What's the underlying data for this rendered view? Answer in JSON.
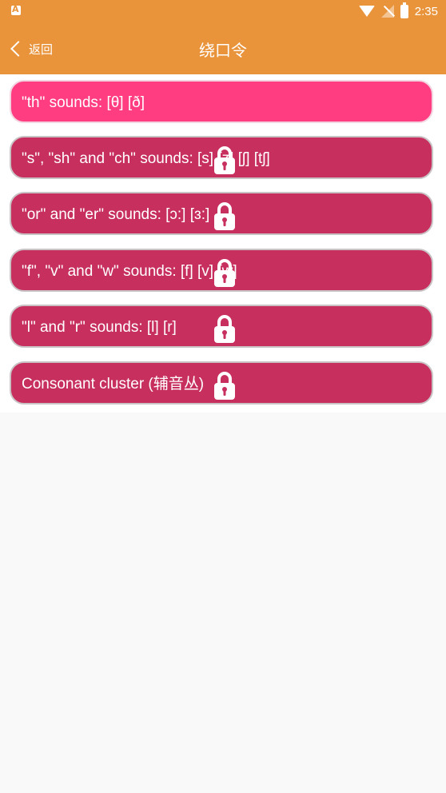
{
  "status_bar": {
    "time": "2:35"
  },
  "nav": {
    "back_label": "返回",
    "title": "绕口令"
  },
  "items": [
    {
      "label": "\"th\" sounds: [θ] [ð]",
      "locked": false
    },
    {
      "label": "\"s\", \"sh\" and \"ch\" sounds: [s] [z] [ʃ] [tʃ]",
      "locked": true
    },
    {
      "label": "\"or\" and \"er\" sounds: [ɔ:] [ɜ:]",
      "locked": true
    },
    {
      "label": "\"f\", \"v\" and \"w\" sounds: [f] [v] [w]",
      "locked": true
    },
    {
      "label": "\"l\" and \"r\" sounds: [l] [r]",
      "locked": true
    },
    {
      "label": "Consonant cluster (辅音丛)",
      "locked": true
    }
  ],
  "colors": {
    "header": "#e9933a",
    "item_active": "#ff3d80",
    "item_locked": "#c72f5f"
  }
}
